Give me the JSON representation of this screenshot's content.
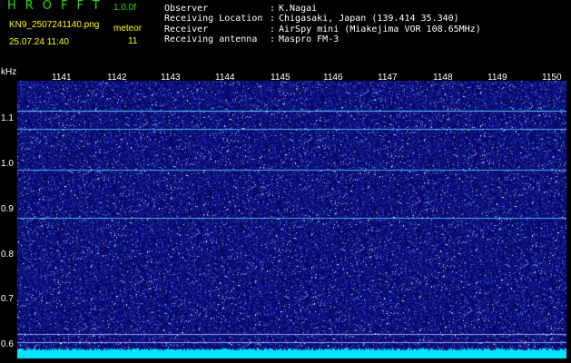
{
  "header": {
    "app_title": "HROFFT",
    "version": "1.0.0f",
    "filename": "KN9_2507241140.png",
    "datetime": "25.07.24 11:40",
    "mode": "meteor",
    "count": "11"
  },
  "station_info": [
    {
      "label": "Observer",
      "value": "K.Nagai"
    },
    {
      "label": "Receiving Location",
      "value": "Chigasaki, Japan (139.414 35.340)"
    },
    {
      "label": "Receiver",
      "value": "AirSpy mini (Miakejima VOR 108.65MHz)"
    },
    {
      "label": "Receiving antenna",
      "value": "Maspro FM-3"
    }
  ],
  "axis": {
    "y_unit": "kHz",
    "time_ticks": [
      "1141",
      "1142",
      "1143",
      "1144",
      "1145",
      "1146",
      "1147",
      "1148",
      "1149",
      "1150"
    ],
    "freq_ticks": [
      "1.1",
      "1.0",
      "0.9",
      "0.8",
      "0.7",
      "0.6"
    ]
  },
  "colors": {
    "label_text": "#ffff00",
    "title_text": "#22e000",
    "spectrogram_bg": "#0a0a7a",
    "noise_floor": "#00e5ff"
  },
  "spectrogram": {
    "carrier_khz": [
      1.115,
      1.075,
      0.985,
      0.878,
      0.622,
      0.605,
      0.585
    ]
  }
}
